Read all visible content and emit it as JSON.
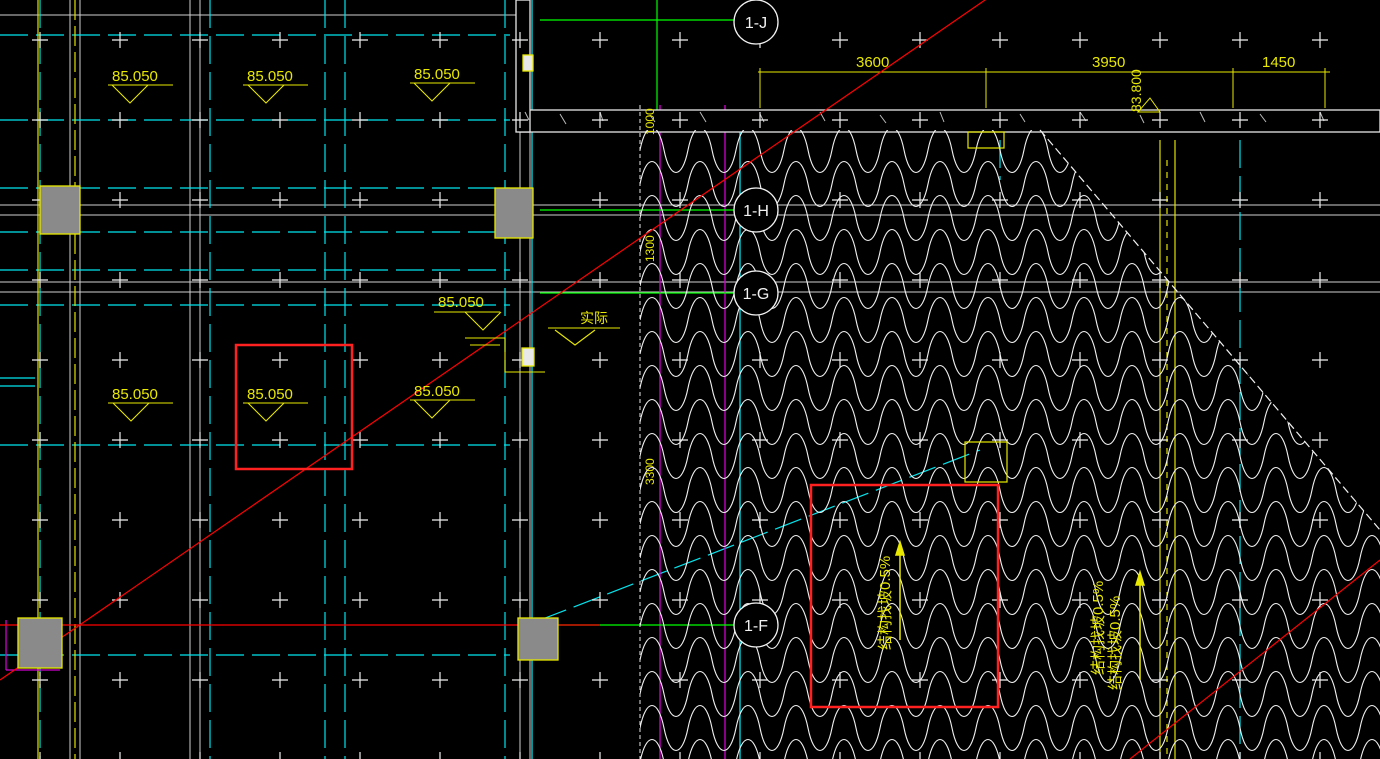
{
  "elevation_labels": [
    "85.050",
    "85.050",
    "85.050",
    "85.050",
    "85.050",
    "85.050",
    "85.050"
  ],
  "grid_bubbles": [
    "1-J",
    "1-H",
    "1-G",
    "1-F"
  ],
  "dimensions_top": [
    "3600",
    "3950",
    "1450"
  ],
  "dimensions_vertical": [
    "83.800",
    "1000",
    "1300",
    "3300"
  ],
  "tags": [
    "实际"
  ],
  "slope_notes": [
    "结构找坡0.5%",
    "结构找坡0.5%",
    "结构找坡0.5%"
  ],
  "colors": {
    "background": "#000000",
    "text": "#ffff00",
    "grid_cross": "#ffffff",
    "axis": "#00ff00",
    "cyan": "#00e5ee",
    "magenta": "#d000d0",
    "red_line": "#ff0000",
    "highlight_box": "#ff2020",
    "column": "#8a8a8a"
  }
}
